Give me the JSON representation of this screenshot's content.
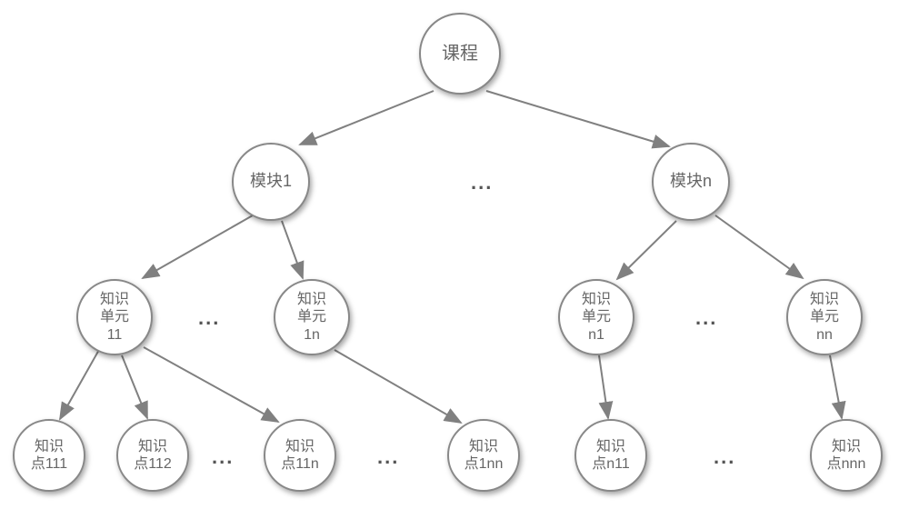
{
  "chart_data": {
    "type": "tree",
    "root": {
      "label": "课程"
    },
    "modules": [
      {
        "id": "m1",
        "label": "模块1"
      },
      {
        "id": "mn",
        "label": "模块n"
      }
    ],
    "units": [
      {
        "id": "u11",
        "parent": "m1",
        "label": "知识\n单元\n11"
      },
      {
        "id": "u1n",
        "parent": "m1",
        "label": "知识\n单元\n1n"
      },
      {
        "id": "un1",
        "parent": "mn",
        "label": "知识\n单元\n n1"
      },
      {
        "id": "unn",
        "parent": "mn",
        "label": "知识\n单元\n nn"
      }
    ],
    "points": [
      {
        "id": "p111",
        "parent": "u11",
        "label": "知识\n点111"
      },
      {
        "id": "p112",
        "parent": "u11",
        "label": "知识\n点112"
      },
      {
        "id": "p11n",
        "parent": "u11",
        "label": "知识\n点11n"
      },
      {
        "id": "p1nn",
        "parent": "u1n",
        "label": "知识\n点1nn"
      },
      {
        "id": "pn11",
        "parent": "un1",
        "label": "知识\n点n11"
      },
      {
        "id": "pnnn",
        "parent": "unn",
        "label": "知识\n点nnn"
      }
    ],
    "ellipsis": "..."
  },
  "colors": {
    "node_border": "#888888",
    "node_shadow": "rgba(0,0,0,0.35)",
    "text": "#666666",
    "arrow": "#808080"
  }
}
